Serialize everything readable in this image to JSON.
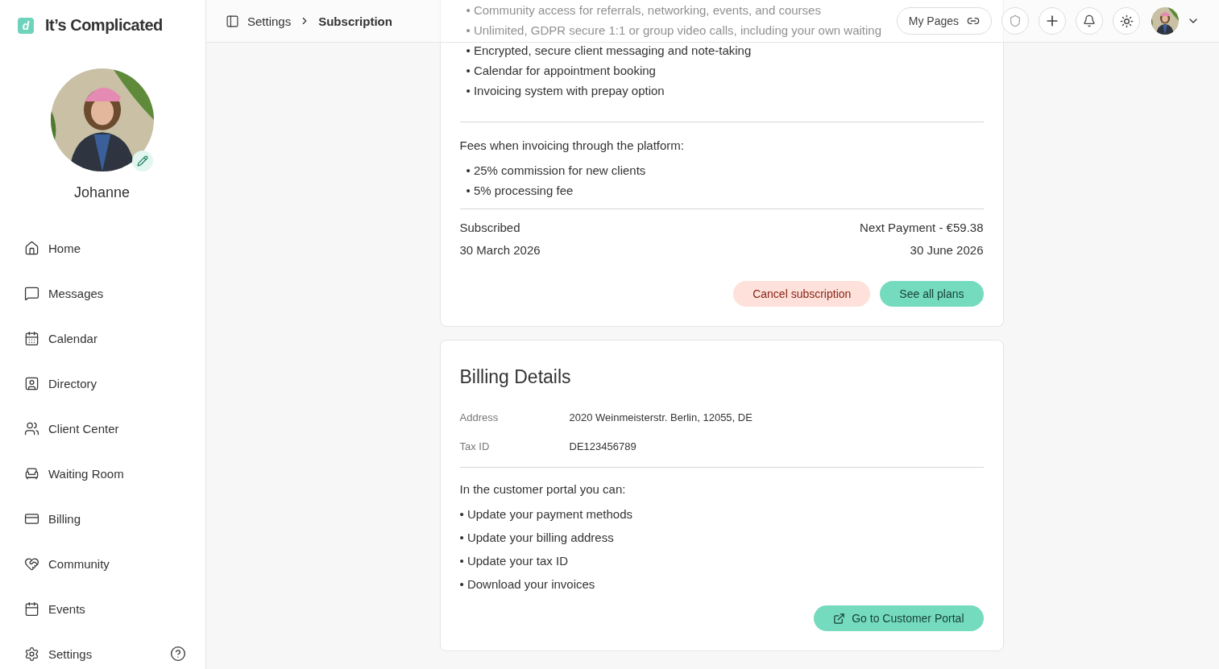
{
  "brand": {
    "logo_letter": "d",
    "name": "It’s Complicated"
  },
  "profile": {
    "name": "Johanne"
  },
  "sidebar": {
    "items": [
      {
        "label": "Home",
        "selected": false
      },
      {
        "label": "Messages",
        "selected": false
      },
      {
        "label": "Calendar",
        "selected": false
      },
      {
        "label": "Directory",
        "selected": false
      },
      {
        "label": "Client Center",
        "selected": false
      },
      {
        "label": "Waiting Room",
        "selected": false
      },
      {
        "label": "Billing",
        "selected": false
      },
      {
        "label": "Community",
        "selected": false
      },
      {
        "label": "Events",
        "selected": false
      },
      {
        "label": "Settings",
        "selected": false
      }
    ]
  },
  "breadcrumb": [
    "Settings",
    "Subscription"
  ],
  "topbar": {
    "my_pages": "My Pages"
  },
  "plan_card": {
    "features": [
      "•  Community access for referrals, networking, events, and courses",
      "•  Unlimited, GDPR secure 1:1 or group video calls, including your own waiting",
      "•  Encrypted, secure client messaging and note-taking",
      "•  Calendar for appointment booking",
      "•  Invoicing system with prepay option"
    ],
    "fees_title": "Fees when invoicing through the platform:",
    "fees": [
      "• 25% commission for new clients",
      "• 5% processing fee"
    ],
    "subscribed_label": "Subscribed",
    "subscribed_date": "30 March 2026",
    "next_payment_label": "Next Payment - €59.38",
    "next_payment_date": "30 June 2026",
    "cancel_button": "Cancel subscription",
    "plans_button": "See all plans"
  },
  "billing_card": {
    "title": "Billing Details",
    "details": [
      {
        "label": "Address",
        "value": "2020 Weinmeisterstr. Berlin, 12055, DE"
      },
      {
        "label": "Tax ID",
        "value": "DE123456789"
      }
    ],
    "portal_intro": "In the customer portal you can:",
    "portal_items": [
      "• Update your payment methods",
      "• Update your billing address",
      "• Update your tax ID",
      "• Download your invoices"
    ],
    "portal_button": "Go to Customer Portal"
  }
}
